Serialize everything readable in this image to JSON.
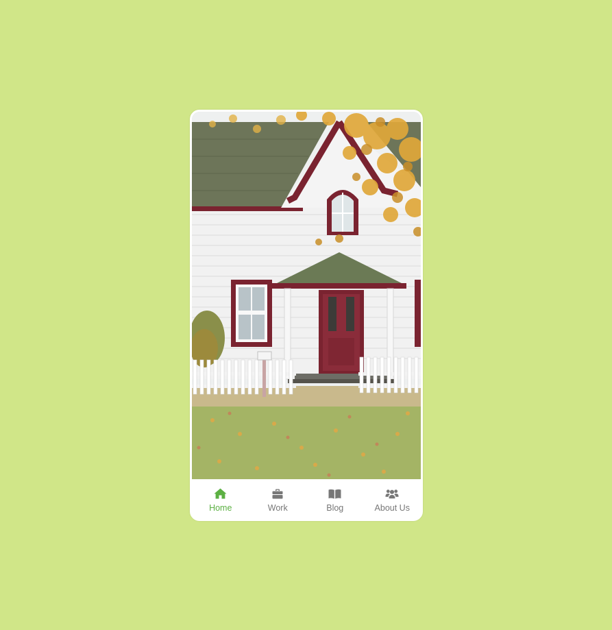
{
  "colors": {
    "background": "#d0e688",
    "accent": "#5cb043",
    "inactive": "#777777"
  },
  "hero": {
    "image_subject": "white house with maroon trim, picket fence and autumn leaves"
  },
  "tabbar": {
    "active": "home",
    "items": [
      {
        "key": "home",
        "label": "Home",
        "icon": "home-icon"
      },
      {
        "key": "work",
        "label": "Work",
        "icon": "briefcase-icon"
      },
      {
        "key": "blog",
        "label": "Blog",
        "icon": "book-icon"
      },
      {
        "key": "about",
        "label": "About Us",
        "icon": "users-icon"
      }
    ]
  }
}
